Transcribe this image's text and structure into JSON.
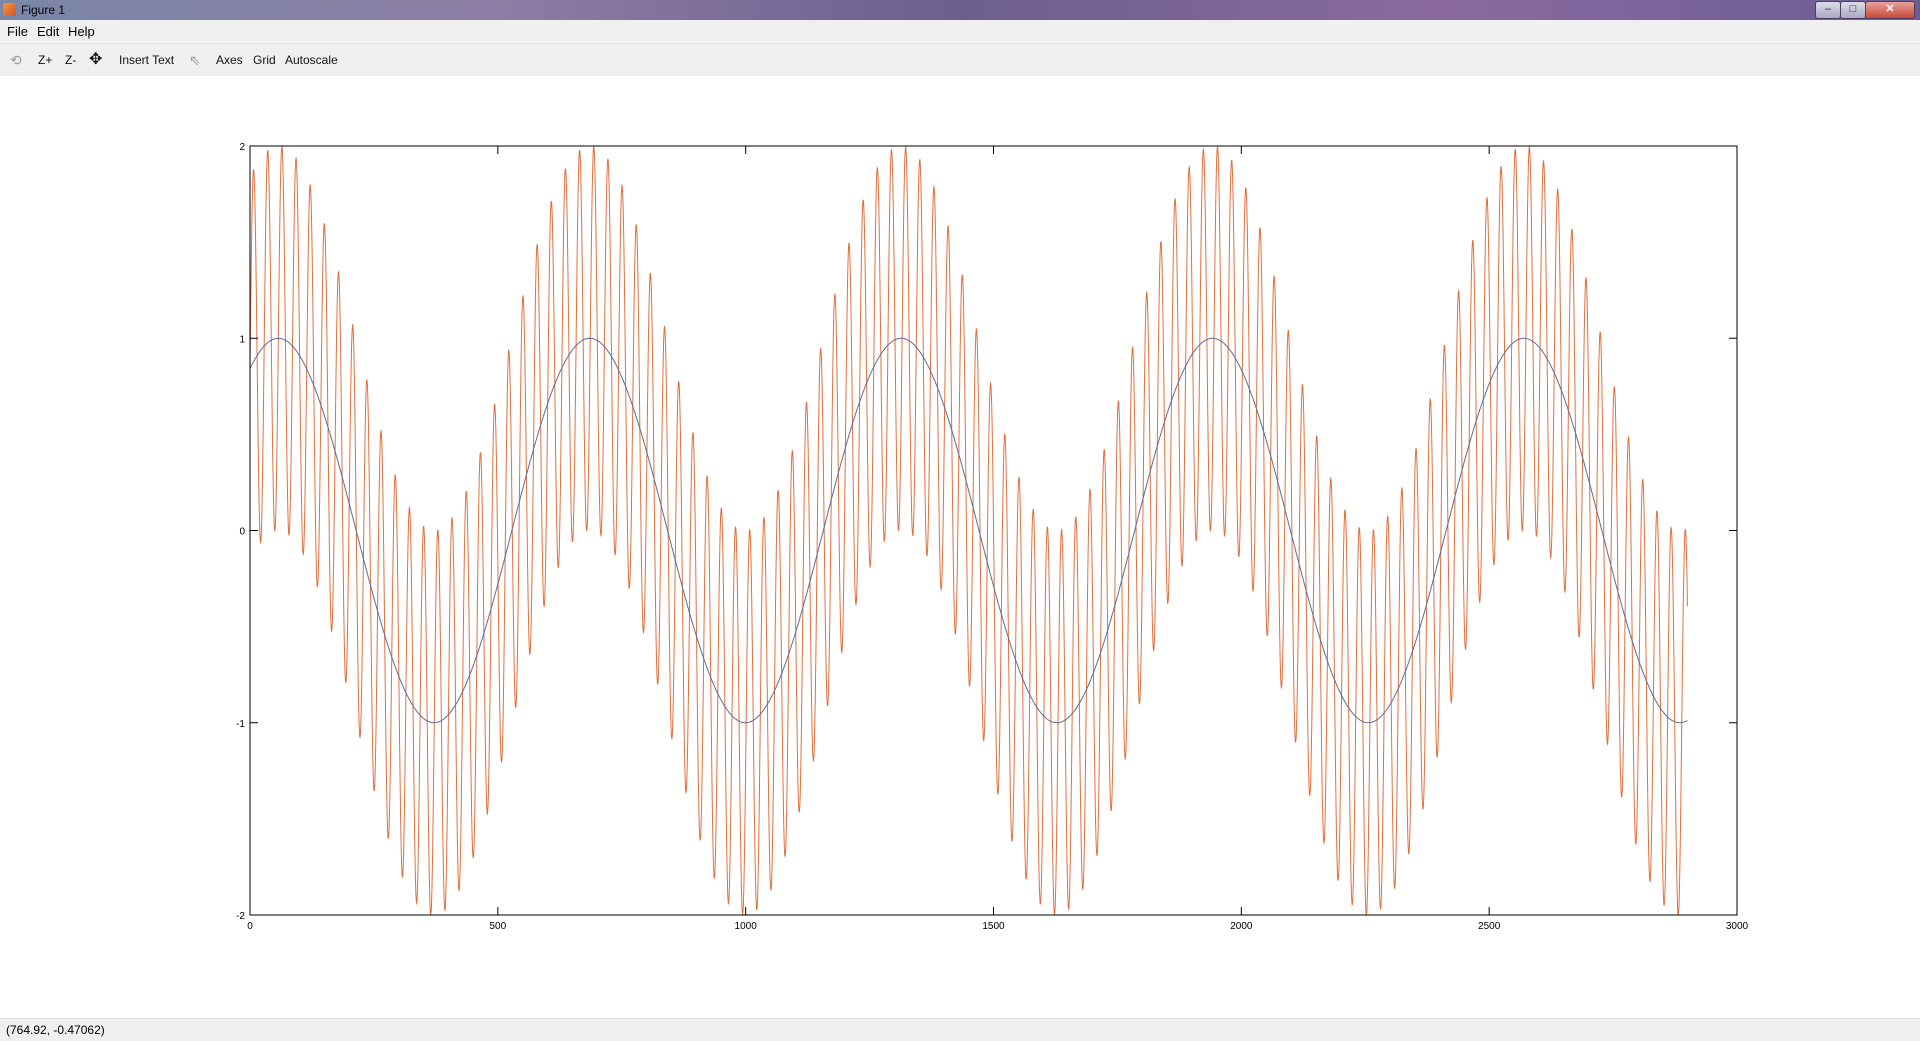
{
  "window": {
    "title": "Figure 1",
    "controls": {
      "minimize": "–",
      "maximize": "□",
      "close": "✕"
    }
  },
  "menu": {
    "items": [
      "File",
      "Edit",
      "Help"
    ]
  },
  "toolbar": {
    "rotate_icon": "rotate-icon",
    "zoom_in": "Z+",
    "zoom_out": "Z-",
    "pan_icon": "pan-icon",
    "insert_text": "Insert Text",
    "select_icon": "pointer-icon",
    "axes": "Axes",
    "grid": "Grid",
    "autoscale": "Autoscale"
  },
  "status": {
    "coordinates": "(764.92, -0.47062)"
  },
  "chart_data": {
    "type": "line",
    "title": "",
    "xlabel": "",
    "ylabel": "",
    "xlim": [
      0,
      3000
    ],
    "ylim": [
      -2,
      2
    ],
    "x_ticks": [
      "0",
      "500",
      "1000",
      "1500",
      "2000",
      "2500",
      "3000"
    ],
    "y_ticks": [
      "2",
      "1",
      "0",
      "-1",
      "-2"
    ],
    "grid": false,
    "series": [
      {
        "color": "#5a6d9a",
        "description_formula": "sin(2*pi*x/628.3 + 1)",
        "x_range": [
          0,
          2900
        ],
        "period": 628.3,
        "amplitude": 1,
        "phase": 1.0,
        "offset": 0
      },
      {
        "color": "#e0703e",
        "description_formula": "sin(2*pi*x/628.3 + 1) + sin(2*pi*x/28.6)",
        "x_range": [
          0,
          2900
        ],
        "period": 628.3,
        "amplitude": 1,
        "phase": 1.0,
        "offset": 0,
        "carrier_period": 28.6,
        "carrier_amplitude": 1
      }
    ]
  }
}
